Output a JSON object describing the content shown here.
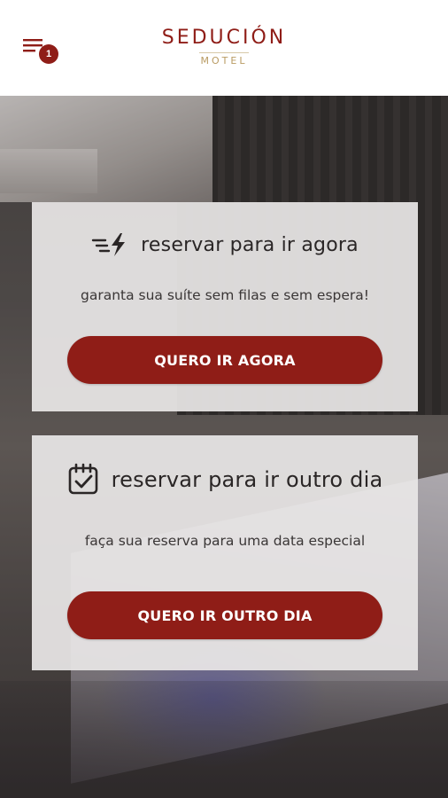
{
  "header": {
    "menu_icon": "menu-icon",
    "notification_count": "1",
    "logo_main": "SEDUCIÓN",
    "logo_sub": "MOTEL"
  },
  "cards": [
    {
      "icon": "lightning-bolt-icon",
      "title": "reservar para ir agora",
      "subtitle": "garanta sua suíte sem filas e sem espera!",
      "button_label": "QUERO IR AGORA"
    },
    {
      "icon": "calendar-check-icon",
      "title": "reservar para ir outro dia",
      "subtitle": "faça sua reserva para uma data especial",
      "button_label": "QUERO IR OUTRO DIA"
    }
  ],
  "colors": {
    "brand": "#8f1d17",
    "gold": "#b99b62",
    "card_bg": "#e8e6e6"
  }
}
